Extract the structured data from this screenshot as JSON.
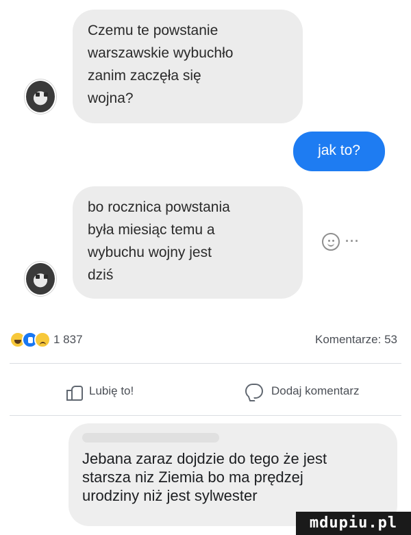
{
  "thread": {
    "message1": {
      "lines": [
        "Czemu te powstanie",
        "warszawskie wybuchło",
        "zanim zaczęła się",
        "wojna?"
      ]
    },
    "reply": {
      "text": "jak to?"
    },
    "message2": {
      "lines": [
        "bo rocznica powstania",
        "była miesiąc temu a",
        "wybuchu wojny jest",
        "dziś"
      ]
    },
    "tools": {
      "more": "···"
    }
  },
  "post_stats": {
    "reactions": [
      "haha-icon",
      "like-icon",
      "sad-icon"
    ],
    "reaction_count": "1 837",
    "comments_label": "Komentarze: 53"
  },
  "actions": {
    "like_label": "Lubię to!",
    "comment_label": "Dodaj komentarz"
  },
  "comment": {
    "lines": [
      "Jebana zaraz dojdzie do tego że jest",
      "starsza niz Ziemia bo ma prędzej",
      "urodziny niż jest sylwester"
    ]
  },
  "watermark": {
    "text": "mdupiu.pl"
  },
  "colors": {
    "accent": "#1e7cf2",
    "bubble": "#ececec",
    "text": "#1c1e21"
  }
}
